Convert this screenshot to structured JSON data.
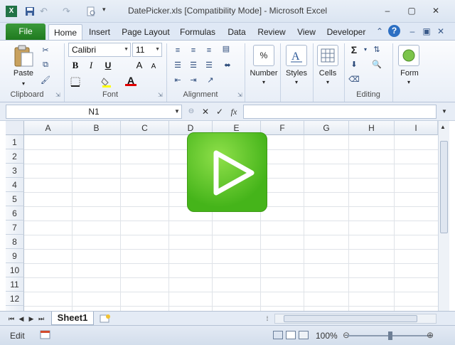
{
  "window": {
    "title": "DatePicker.xls  [Compatibility Mode]  -  Microsoft Excel",
    "controls": {
      "minimize": "–",
      "restore": "▢",
      "close": "✕"
    }
  },
  "ribbon_tabs": [
    {
      "label": "File"
    },
    {
      "label": "Home"
    },
    {
      "label": "Insert"
    },
    {
      "label": "Page Layout"
    },
    {
      "label": "Formulas"
    },
    {
      "label": "Data"
    },
    {
      "label": "Review"
    },
    {
      "label": "View"
    },
    {
      "label": "Developer"
    }
  ],
  "ribbon": {
    "clipboard": {
      "label": "Clipboard",
      "paste": "Paste"
    },
    "font": {
      "label": "Font",
      "name": "Calibri",
      "size": "11",
      "bold": "B",
      "italic": "I",
      "underline": "U",
      "grow": "A",
      "shrink": "A",
      "color": "A"
    },
    "alignment": {
      "label": "Alignment"
    },
    "number": {
      "label": "Number",
      "symbol": "%"
    },
    "styles": {
      "label": "Styles"
    },
    "cells": {
      "label": "Cells"
    },
    "editing": {
      "label": "Editing",
      "sum": "Σ"
    },
    "form": {
      "label": "Form"
    }
  },
  "formula_bar": {
    "name_box": "N1",
    "fx": "fx",
    "cancel": "✕",
    "enter": "✓",
    "value": ""
  },
  "columns": [
    "A",
    "B",
    "C",
    "D",
    "E",
    "F",
    "G",
    "H",
    "I"
  ],
  "rows": [
    "1",
    "2",
    "3",
    "4",
    "5",
    "6",
    "7",
    "8",
    "9",
    "10",
    "11",
    "12"
  ],
  "sheets": [
    {
      "label": "Sheet1"
    }
  ],
  "status": {
    "mode": "Edit",
    "zoom": "100%"
  },
  "colors": {
    "file_tab": "#2a8a2a",
    "play": "#45b41a",
    "accent": "#2b5797"
  },
  "icons": [
    "excel-logo-icon",
    "save-icon",
    "undo-icon",
    "redo-icon",
    "print-preview-icon",
    "play-icon"
  ]
}
